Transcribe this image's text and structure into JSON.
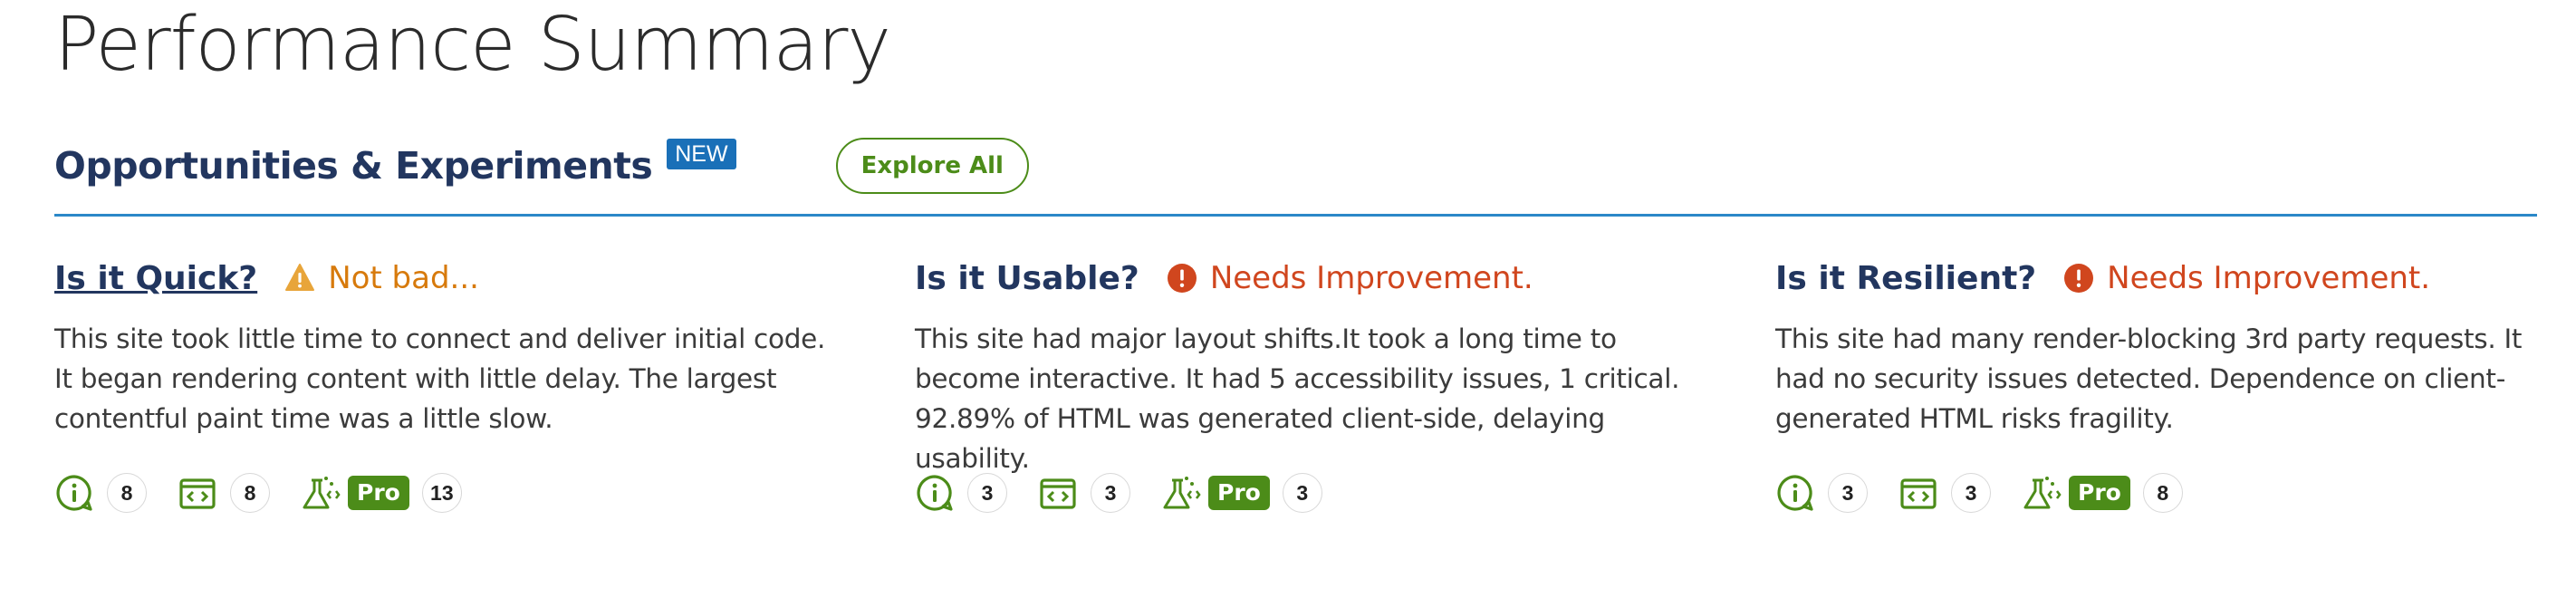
{
  "page": {
    "title": "Performance Summary"
  },
  "section": {
    "title": "Opportunities & Experiments",
    "badge": "NEW",
    "explore_label": "Explore All",
    "accent_color": "#4c8c19",
    "title_color": "#22365f",
    "divider_color": "#2b88c8"
  },
  "cards": [
    {
      "title": "Is it Quick?",
      "status_icon": "warning-triangle-icon",
      "status": "Not bad...",
      "status_color": "#d77a0c",
      "description": "This site took little time to connect and deliver initial code. It began rendering content with little delay. The largest contentful paint time was a little slow.",
      "metrics": {
        "info": "8",
        "code": "8",
        "pro_label": "Pro",
        "experiments": "13"
      }
    },
    {
      "title": "Is it Usable?",
      "status_icon": "alert-circle-icon",
      "status": "Needs Improvement.",
      "status_color": "#d0461e",
      "description": "This site had major layout shifts.It took a long time to become interactive. It had 5 accessibility issues, 1 critical. 92.89% of HTML was generated client-side, delaying usability.",
      "metrics": {
        "info": "3",
        "code": "3",
        "pro_label": "Pro",
        "experiments": "3"
      }
    },
    {
      "title": "Is it Resilient?",
      "status_icon": "alert-circle-icon",
      "status": "Needs Improvement.",
      "status_color": "#d0461e",
      "description": "This site had many render-blocking 3rd party requests. It had no security issues detected. Dependence on client-generated HTML risks fragility.",
      "metrics": {
        "info": "3",
        "code": "3",
        "pro_label": "Pro",
        "experiments": "8"
      }
    }
  ]
}
